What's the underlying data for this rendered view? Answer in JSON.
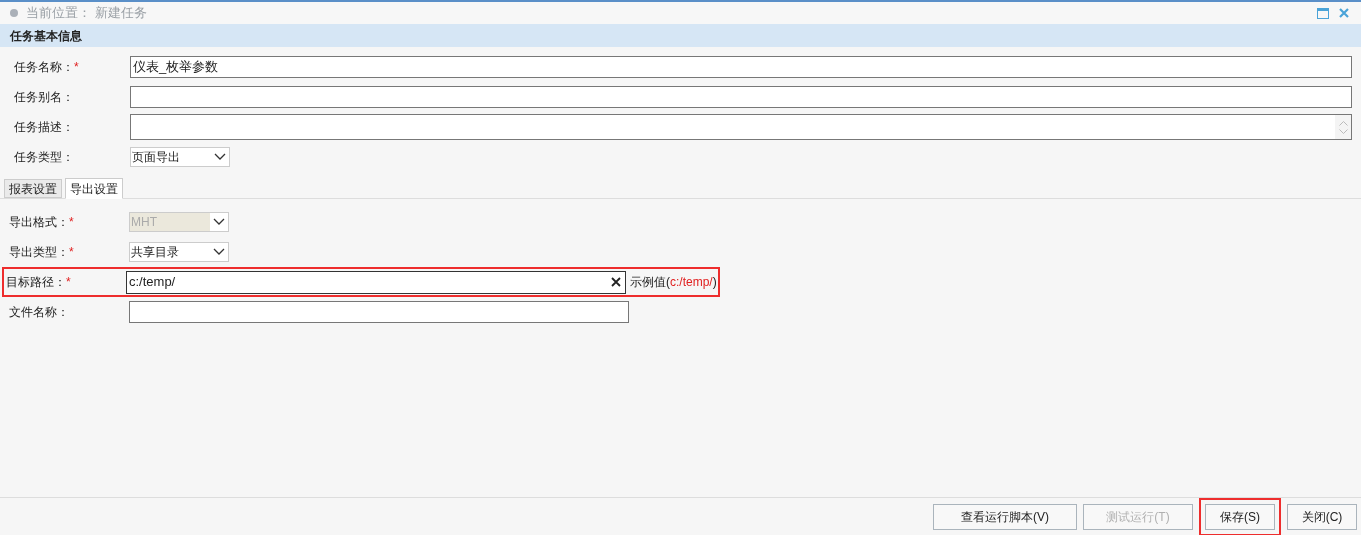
{
  "window": {
    "breadcrumb_label": "当前位置：",
    "breadcrumb_value": "新建任务"
  },
  "section": {
    "title": "任务基本信息"
  },
  "basic_fields": [
    {
      "kind": "text",
      "label": "任务名称：",
      "required_mark": "*",
      "value": "仪表_枚举参数"
    },
    {
      "kind": "text",
      "label": "任务别名："
    },
    {
      "kind": "textarea",
      "label": "任务描述："
    },
    {
      "kind": "select",
      "label": "任务类型：",
      "value": "页面导出",
      "disabled": false
    }
  ],
  "tabs": [
    {
      "label": "报表设置",
      "selected": false
    },
    {
      "label": "导出设置",
      "selected": true
    }
  ],
  "export_fields": [
    {
      "kind": "select",
      "label": "导出格式：",
      "required_mark": "*",
      "value": "MHT",
      "disabled": true,
      "highlighted": false
    },
    {
      "kind": "select",
      "label": "导出类型：",
      "required_mark": "*",
      "value": "共享目录",
      "disabled": false,
      "highlighted": false
    },
    {
      "kind": "clearable",
      "label": "目标路径：",
      "required_mark": "*",
      "value": "c:/temp/",
      "highlighted": true,
      "hint_prefix": "示例值(",
      "hint_value": "c:/temp/",
      "hint_suffix": ")"
    },
    {
      "kind": "text",
      "label": "文件名称：",
      "highlighted": false
    }
  ],
  "buttons": [
    {
      "label": "查看运行脚本(V)",
      "disabled": false,
      "highlighted": false
    },
    {
      "label": "测试运行(T)",
      "disabled": true,
      "highlighted": false
    },
    {
      "label": "保存(S)",
      "disabled": false,
      "highlighted": true
    },
    {
      "label": "关闭(C)",
      "disabled": false,
      "highlighted": false
    }
  ]
}
